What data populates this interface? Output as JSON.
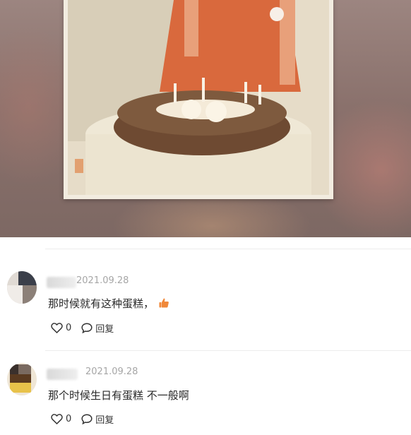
{
  "comments": [
    {
      "date": "2021.09.28",
      "text": "那时候就有这种蛋糕，",
      "emoji_icon": "thumbs-up-icon",
      "likes": "0",
      "reply_label": "回复"
    },
    {
      "date": "2021.09.28",
      "text": "那个时候生日有蛋糕 不一般啊",
      "likes": "0",
      "reply_label": "回复"
    }
  ],
  "colors": {
    "divider": "#ececec",
    "date": "#a6a6a6",
    "emoji": "#f0883a"
  }
}
